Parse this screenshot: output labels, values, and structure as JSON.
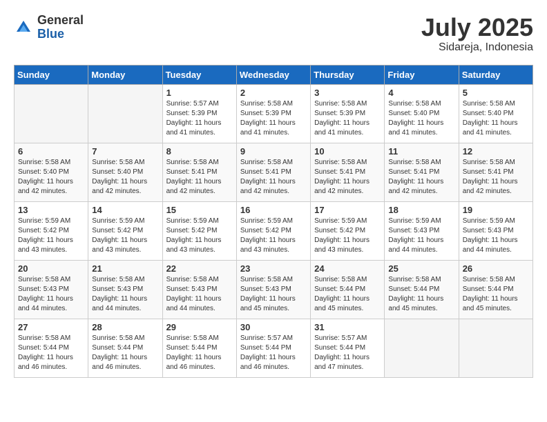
{
  "logo": {
    "general": "General",
    "blue": "Blue"
  },
  "title": "July 2025",
  "location": "Sidareja, Indonesia",
  "days_of_week": [
    "Sunday",
    "Monday",
    "Tuesday",
    "Wednesday",
    "Thursday",
    "Friday",
    "Saturday"
  ],
  "weeks": [
    [
      {
        "day": "",
        "info": ""
      },
      {
        "day": "",
        "info": ""
      },
      {
        "day": "1",
        "info": "Sunrise: 5:57 AM\nSunset: 5:39 PM\nDaylight: 11 hours and 41 minutes."
      },
      {
        "day": "2",
        "info": "Sunrise: 5:58 AM\nSunset: 5:39 PM\nDaylight: 11 hours and 41 minutes."
      },
      {
        "day": "3",
        "info": "Sunrise: 5:58 AM\nSunset: 5:39 PM\nDaylight: 11 hours and 41 minutes."
      },
      {
        "day": "4",
        "info": "Sunrise: 5:58 AM\nSunset: 5:40 PM\nDaylight: 11 hours and 41 minutes."
      },
      {
        "day": "5",
        "info": "Sunrise: 5:58 AM\nSunset: 5:40 PM\nDaylight: 11 hours and 41 minutes."
      }
    ],
    [
      {
        "day": "6",
        "info": "Sunrise: 5:58 AM\nSunset: 5:40 PM\nDaylight: 11 hours and 42 minutes."
      },
      {
        "day": "7",
        "info": "Sunrise: 5:58 AM\nSunset: 5:40 PM\nDaylight: 11 hours and 42 minutes."
      },
      {
        "day": "8",
        "info": "Sunrise: 5:58 AM\nSunset: 5:41 PM\nDaylight: 11 hours and 42 minutes."
      },
      {
        "day": "9",
        "info": "Sunrise: 5:58 AM\nSunset: 5:41 PM\nDaylight: 11 hours and 42 minutes."
      },
      {
        "day": "10",
        "info": "Sunrise: 5:58 AM\nSunset: 5:41 PM\nDaylight: 11 hours and 42 minutes."
      },
      {
        "day": "11",
        "info": "Sunrise: 5:58 AM\nSunset: 5:41 PM\nDaylight: 11 hours and 42 minutes."
      },
      {
        "day": "12",
        "info": "Sunrise: 5:58 AM\nSunset: 5:41 PM\nDaylight: 11 hours and 42 minutes."
      }
    ],
    [
      {
        "day": "13",
        "info": "Sunrise: 5:59 AM\nSunset: 5:42 PM\nDaylight: 11 hours and 43 minutes."
      },
      {
        "day": "14",
        "info": "Sunrise: 5:59 AM\nSunset: 5:42 PM\nDaylight: 11 hours and 43 minutes."
      },
      {
        "day": "15",
        "info": "Sunrise: 5:59 AM\nSunset: 5:42 PM\nDaylight: 11 hours and 43 minutes."
      },
      {
        "day": "16",
        "info": "Sunrise: 5:59 AM\nSunset: 5:42 PM\nDaylight: 11 hours and 43 minutes."
      },
      {
        "day": "17",
        "info": "Sunrise: 5:59 AM\nSunset: 5:42 PM\nDaylight: 11 hours and 43 minutes."
      },
      {
        "day": "18",
        "info": "Sunrise: 5:59 AM\nSunset: 5:43 PM\nDaylight: 11 hours and 44 minutes."
      },
      {
        "day": "19",
        "info": "Sunrise: 5:59 AM\nSunset: 5:43 PM\nDaylight: 11 hours and 44 minutes."
      }
    ],
    [
      {
        "day": "20",
        "info": "Sunrise: 5:58 AM\nSunset: 5:43 PM\nDaylight: 11 hours and 44 minutes."
      },
      {
        "day": "21",
        "info": "Sunrise: 5:58 AM\nSunset: 5:43 PM\nDaylight: 11 hours and 44 minutes."
      },
      {
        "day": "22",
        "info": "Sunrise: 5:58 AM\nSunset: 5:43 PM\nDaylight: 11 hours and 44 minutes."
      },
      {
        "day": "23",
        "info": "Sunrise: 5:58 AM\nSunset: 5:43 PM\nDaylight: 11 hours and 45 minutes."
      },
      {
        "day": "24",
        "info": "Sunrise: 5:58 AM\nSunset: 5:44 PM\nDaylight: 11 hours and 45 minutes."
      },
      {
        "day": "25",
        "info": "Sunrise: 5:58 AM\nSunset: 5:44 PM\nDaylight: 11 hours and 45 minutes."
      },
      {
        "day": "26",
        "info": "Sunrise: 5:58 AM\nSunset: 5:44 PM\nDaylight: 11 hours and 45 minutes."
      }
    ],
    [
      {
        "day": "27",
        "info": "Sunrise: 5:58 AM\nSunset: 5:44 PM\nDaylight: 11 hours and 46 minutes."
      },
      {
        "day": "28",
        "info": "Sunrise: 5:58 AM\nSunset: 5:44 PM\nDaylight: 11 hours and 46 minutes."
      },
      {
        "day": "29",
        "info": "Sunrise: 5:58 AM\nSunset: 5:44 PM\nDaylight: 11 hours and 46 minutes."
      },
      {
        "day": "30",
        "info": "Sunrise: 5:57 AM\nSunset: 5:44 PM\nDaylight: 11 hours and 46 minutes."
      },
      {
        "day": "31",
        "info": "Sunrise: 5:57 AM\nSunset: 5:44 PM\nDaylight: 11 hours and 47 minutes."
      },
      {
        "day": "",
        "info": ""
      },
      {
        "day": "",
        "info": ""
      }
    ]
  ]
}
